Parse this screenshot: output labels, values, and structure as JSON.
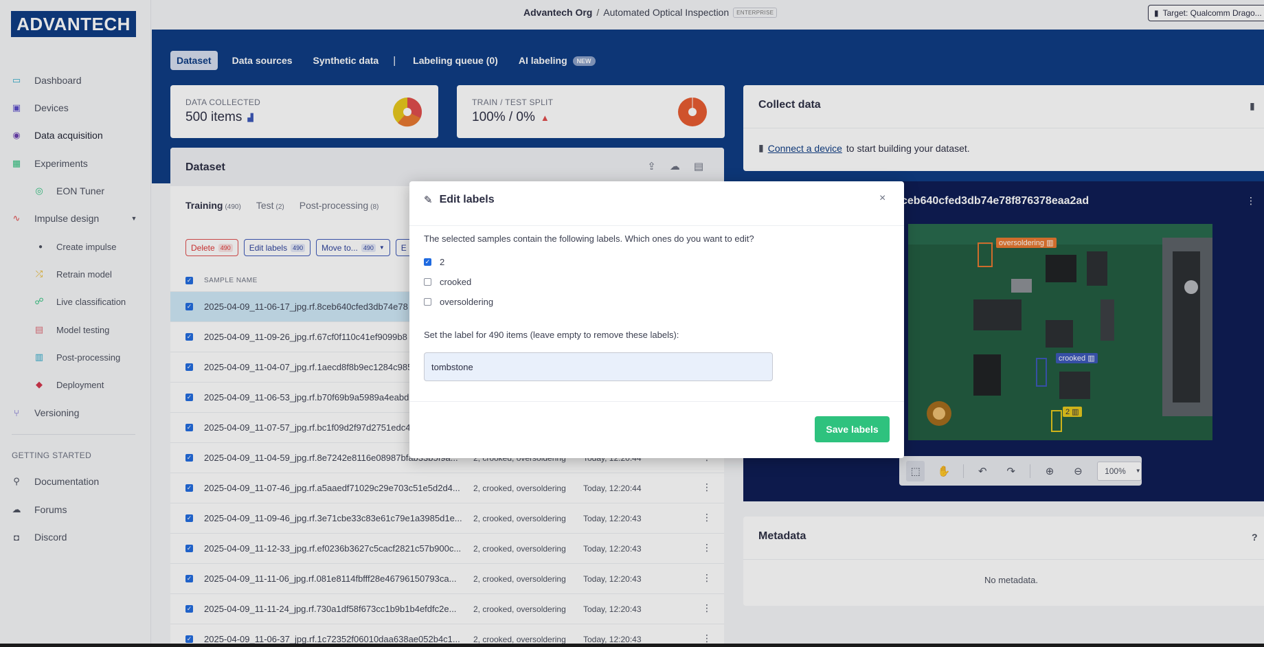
{
  "sidebar": {
    "logo": "ADVANTECH",
    "items": [
      {
        "label": "Dashboard",
        "icon": "monitor-icon"
      },
      {
        "label": "Devices",
        "icon": "chip-icon"
      },
      {
        "label": "Data acquisition",
        "icon": "database-icon"
      },
      {
        "label": "Experiments",
        "icon": "table-icon"
      },
      {
        "label": "EON Tuner",
        "icon": "compass-icon"
      },
      {
        "label": "Impulse design",
        "icon": "pulse-icon"
      },
      {
        "label": "Create impulse",
        "icon": "dot-icon"
      },
      {
        "label": "Retrain model",
        "icon": "shuffle-icon"
      },
      {
        "label": "Live classification",
        "icon": "network-icon"
      },
      {
        "label": "Model testing",
        "icon": "clipboard-icon"
      },
      {
        "label": "Post-processing",
        "icon": "doc-icon"
      },
      {
        "label": "Deployment",
        "icon": "cube-icon"
      },
      {
        "label": "Versioning",
        "icon": "branch-icon"
      }
    ],
    "getting_started_label": "GETTING STARTED",
    "help_items": [
      {
        "label": "Documentation",
        "icon": "book-icon"
      },
      {
        "label": "Forums",
        "icon": "chat-icon"
      },
      {
        "label": "Discord",
        "icon": "discord-icon"
      }
    ]
  },
  "topbar": {
    "org": "Advantech Org",
    "separator": "/",
    "project": "Automated Optical Inspection",
    "badge": "ENTERPRISE",
    "target": "Target: Qualcomm Drago..."
  },
  "tabs": [
    {
      "label": "Dataset",
      "active": true
    },
    {
      "label": "Data sources"
    },
    {
      "label": "Synthetic data"
    },
    {
      "label": "Labeling queue (0)"
    },
    {
      "label": "AI labeling",
      "badge": "NEW"
    }
  ],
  "tab_separator": "|",
  "stats": {
    "collected_label": "DATA COLLECTED",
    "collected_value": "500 items",
    "split_label": "TRAIN / TEST SPLIT",
    "split_value": "100% / 0%"
  },
  "collect": {
    "title": "Collect data",
    "link": "Connect a device",
    "text": "to start building your dataset."
  },
  "dataset": {
    "title": "Dataset",
    "tabs": [
      {
        "label": "Training",
        "count": "(490)",
        "active": true
      },
      {
        "label": "Test",
        "count": "(2)"
      },
      {
        "label": "Post-processing",
        "count": "(8)"
      }
    ],
    "actions": {
      "delete": "Delete",
      "delete_count": "490",
      "edit": "Edit labels",
      "edit_count": "490",
      "move": "Move to...",
      "move_count": "490",
      "partial": "E"
    },
    "col_sample_name": "SAMPLE NAME",
    "rows": [
      {
        "name": "2025-04-09_11-06-17_jpg.rf.8ceb640cfed3db74e78",
        "labels": "",
        "added": "",
        "selected": true
      },
      {
        "name": "2025-04-09_11-09-26_jpg.rf.67cf0f110c41ef9099b8",
        "labels": "",
        "added": ""
      },
      {
        "name": "2025-04-09_11-04-07_jpg.rf.1aecd8f8b9ec1284c985",
        "labels": "",
        "added": ""
      },
      {
        "name": "2025-04-09_11-06-53_jpg.rf.b70f69b9a5989a4eabd",
        "labels": "",
        "added": ""
      },
      {
        "name": "2025-04-09_11-07-57_jpg.rf.bc1f09d2f97d2751edc4",
        "labels": "",
        "added": ""
      },
      {
        "name": "2025-04-09_11-04-59_jpg.rf.8e7242e8116e08987bfab33b5f9a...",
        "labels": "2, crooked, oversoldering",
        "added": "Today, 12:20:44"
      },
      {
        "name": "2025-04-09_11-07-46_jpg.rf.a5aaedf71029c29e703c51e5d2d4...",
        "labels": "2, crooked, oversoldering",
        "added": "Today, 12:20:44"
      },
      {
        "name": "2025-04-09_11-09-46_jpg.rf.3e71cbe33c83e61c79e1a3985d1e...",
        "labels": "2, crooked, oversoldering",
        "added": "Today, 12:20:43"
      },
      {
        "name": "2025-04-09_11-12-33_jpg.rf.ef0236b3627c5cacf2821c57b900c...",
        "labels": "2, crooked, oversoldering",
        "added": "Today, 12:20:43"
      },
      {
        "name": "2025-04-09_11-11-06_jpg.rf.081e8114fbfff28e46796150793ca...",
        "labels": "2, crooked, oversoldering",
        "added": "Today, 12:20:43"
      },
      {
        "name": "2025-04-09_11-11-24_jpg.rf.730a1df58f673cc1b9b1b4efdfc2e...",
        "labels": "2, crooked, oversoldering",
        "added": "Today, 12:20:43"
      },
      {
        "name": "2025-04-09_11-06-37_jpg.rf.1c72352f06010daa638ae052b4c1...",
        "labels": "2, crooked, oversoldering",
        "added": "Today, 12:20:43"
      }
    ]
  },
  "image_panel": {
    "title": "ceb640cfed3db74e78f876378eaa2ad",
    "boxes": [
      {
        "label": "oversoldering",
        "color": "#e8772e"
      },
      {
        "label": "crooked",
        "color": "#3a56b8"
      },
      {
        "label": "2",
        "color": "#e8c81a"
      }
    ],
    "zoom": "100%"
  },
  "metadata": {
    "title": "Metadata",
    "help": "?",
    "empty": "No metadata."
  },
  "modal": {
    "title": "Edit labels",
    "close": "×",
    "question": "The selected samples contain the following labels. Which ones do you want to edit?",
    "options": [
      {
        "label": "2",
        "checked": true
      },
      {
        "label": "crooked",
        "checked": false
      },
      {
        "label": "oversoldering",
        "checked": false
      }
    ],
    "set_label_text": "Set the label for 490 items (leave empty to remove these labels):",
    "input_value": "tombstone",
    "save": "Save labels"
  },
  "colors": {
    "brand_blue": "#0b3a82",
    "save_green": "#2ec27e",
    "delete_red": "#e04a4a"
  }
}
